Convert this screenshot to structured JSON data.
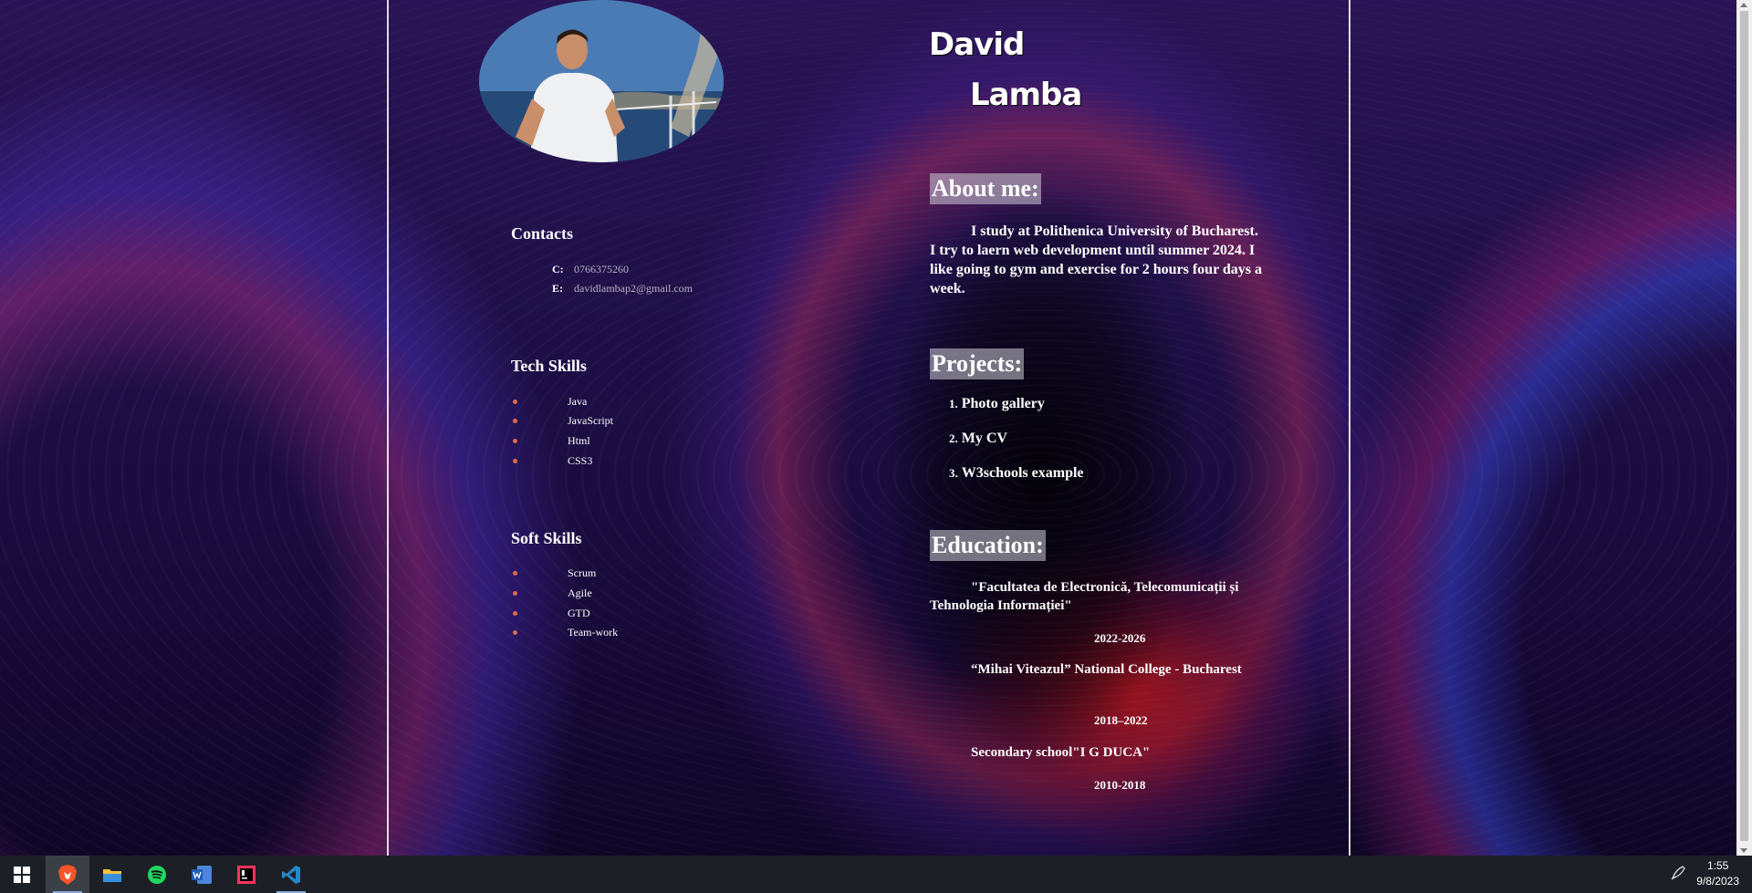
{
  "profile": {
    "first_name": "David",
    "last_name": "Lamba"
  },
  "contacts": {
    "heading": "Contacts",
    "phone_key": "C:",
    "phone": "0766375260",
    "email_key": "E:",
    "email": "davidlambap2@gmail.com"
  },
  "tech_skills": {
    "heading": "Tech Skills",
    "items": [
      "Java",
      "JavaScript",
      "Html",
      "CSS3"
    ]
  },
  "soft_skills": {
    "heading": "Soft Skills",
    "items": [
      "Scrum",
      "Agile",
      "GTD",
      "Team-work"
    ]
  },
  "about": {
    "heading": "About me:",
    "text": "I study at Polithenica University of Bucharest. I try to laern web development until summer 2024. I like going to gym and exercise for 2 hours four days a week."
  },
  "projects": {
    "heading": "Projects:",
    "items": [
      {
        "num": "1.",
        "label": "Photo gallery"
      },
      {
        "num": "2.",
        "label": "My CV"
      },
      {
        "num": "3.",
        "label": "W3schools example"
      }
    ]
  },
  "education": {
    "heading": "Education:",
    "items": [
      {
        "school": "\"Facultatea de Electronică, Telecomunicații și Tehnologia Informației\"",
        "years": "2022-2026"
      },
      {
        "school": "“Mihai Viteazul” National College - Bucharest",
        "years": "2018–2022"
      },
      {
        "school": "Secondary school\"I G DUCA\"",
        "years": "2010-2018"
      }
    ]
  },
  "taskbar": {
    "icons": [
      "windows-start-icon",
      "brave-browser-icon",
      "file-explorer-icon",
      "spotify-icon",
      "word-icon",
      "intellij-icon",
      "vscode-icon"
    ],
    "time": "1:55",
    "date": "9/8/2023"
  },
  "colors": {
    "bullet": "#e06a4a",
    "heading_highlight": "#cdcdd7",
    "contact_value": "#b9b2c7",
    "taskbar": "#1c2026"
  }
}
